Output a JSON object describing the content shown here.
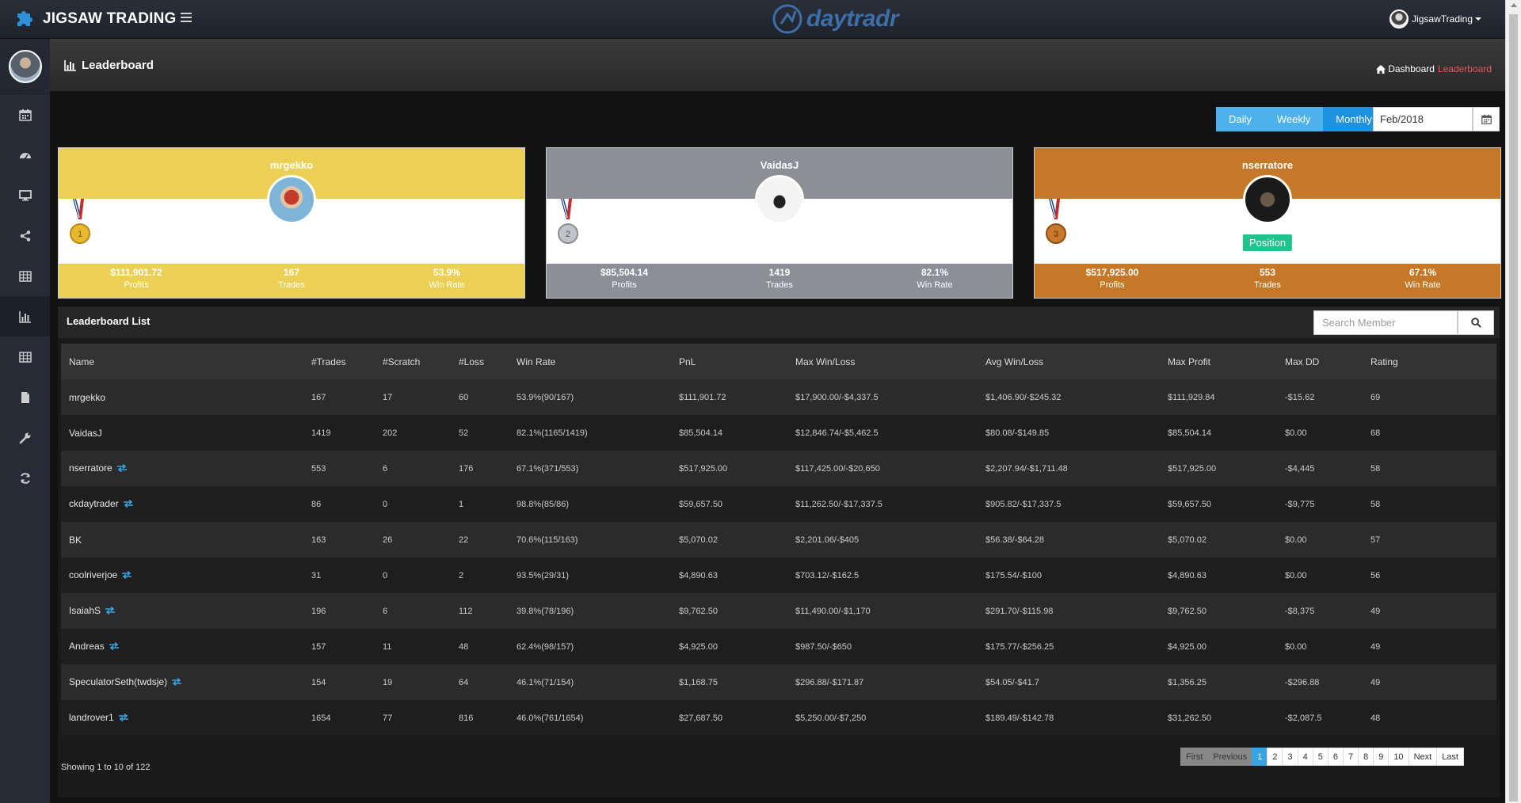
{
  "brand": {
    "name": "JIGSAW TRADING",
    "center_logo": "daytradr"
  },
  "user_menu": {
    "username": "JigsawTrading"
  },
  "sidebar": {
    "items": [
      {
        "icon": "calendar-icon"
      },
      {
        "icon": "dashboard-icon"
      },
      {
        "icon": "monitor-icon"
      },
      {
        "icon": "share-icon"
      },
      {
        "icon": "table-icon"
      },
      {
        "icon": "bar-chart-icon",
        "active": true
      },
      {
        "icon": "table-icon"
      },
      {
        "icon": "file-icon"
      },
      {
        "icon": "wrench-icon"
      },
      {
        "icon": "refresh-icon"
      }
    ]
  },
  "page": {
    "title": "Leaderboard"
  },
  "breadcrumb": {
    "home": "Dashboard",
    "current": "Leaderboard"
  },
  "filters": {
    "daily": "Daily",
    "weekly": "Weekly",
    "monthly": "Monthly",
    "active": "Monthly",
    "date": "Feb/2018"
  },
  "podium": [
    {
      "rank": 1,
      "name": "mrgekko",
      "color": "#ecd055",
      "profits": "$111,901.72",
      "trades": "167",
      "win_rate": "53.9%",
      "badge": ""
    },
    {
      "rank": 2,
      "name": "VaidasJ",
      "color": "#8c8f96",
      "profits": "$85,504.14",
      "trades": "1419",
      "win_rate": "82.1%",
      "badge": ""
    },
    {
      "rank": 3,
      "name": "nserratore",
      "color": "#c57827",
      "profits": "$517,925.00",
      "trades": "553",
      "win_rate": "67.1%",
      "badge": "Position"
    }
  ],
  "podium_labels": {
    "profits": "Profits",
    "trades": "Trades",
    "win_rate": "Win Rate"
  },
  "list": {
    "title": "Leaderboard List",
    "search_placeholder": "Search Member",
    "columns": [
      "Name",
      "#Trades",
      "#Scratch",
      "#Loss",
      "Win Rate",
      "PnL",
      "Max Win/Loss",
      "Avg Win/Loss",
      "Max Profit",
      "Max DD",
      "Rating"
    ],
    "rows": [
      [
        "mrgekko",
        "167",
        "17",
        "60",
        "53.9%(90/167)",
        "$111,901.72",
        "$17,900.00/-$4,337.5",
        "$1,406.90/-$245.32",
        "$111,929.84",
        "-$15.62",
        "69"
      ],
      [
        "VaidasJ",
        "1419",
        "202",
        "52",
        "82.1%(1165/1419)",
        "$85,504.14",
        "$12,846.74/-$5,462.5",
        "$80.08/-$149.85",
        "$85,504.14",
        "$0.00",
        "68"
      ],
      [
        "nserratore",
        "553",
        "6",
        "176",
        "67.1%(371/553)",
        "$517,925.00",
        "$117,425.00/-$20,650",
        "$2,207.94/-$1,711.48",
        "$517,925.00",
        "-$4,445",
        "58"
      ],
      [
        "ckdaytrader",
        "86",
        "0",
        "1",
        "98.8%(85/86)",
        "$59,657.50",
        "$11,262.50/-$17,337.5",
        "$905.82/-$17,337.5",
        "$59,657.50",
        "-$9,775",
        "58"
      ],
      [
        "BK",
        "163",
        "26",
        "22",
        "70.6%(115/163)",
        "$5,070.02",
        "$2,201.06/-$405",
        "$56.38/-$64.28",
        "$5,070.02",
        "$0.00",
        "57"
      ],
      [
        "coolriverjoe",
        "31",
        "0",
        "2",
        "93.5%(29/31)",
        "$4,890.63",
        "$703.12/-$162.5",
        "$175.54/-$100",
        "$4,890.63",
        "$0.00",
        "56"
      ],
      [
        "IsaiahS",
        "196",
        "6",
        "112",
        "39.8%(78/196)",
        "$9,762.50",
        "$11,490.00/-$1,170",
        "$291.70/-$115.98",
        "$9,762.50",
        "-$8,375",
        "49"
      ],
      [
        "Andreas",
        "157",
        "11",
        "48",
        "62.4%(98/157)",
        "$4,925.00",
        "$987.50/-$650",
        "$175.77/-$256.25",
        "$4,925.00",
        "$0.00",
        "49"
      ],
      [
        "SpeculatorSeth(twdsje)",
        "154",
        "19",
        "64",
        "46.1%(71/154)",
        "$1,168.75",
        "$296.88/-$171.87",
        "$54.05/-$41.7",
        "$1,356.25",
        "-$296.88",
        "49"
      ],
      [
        "landrover1",
        "1654",
        "77",
        "816",
        "46.0%(761/1654)",
        "$27,687.50",
        "$5,250.00/-$7,250",
        "$189.49/-$142.78",
        "$31,262.50",
        "-$2,087.5",
        "48"
      ]
    ],
    "swap_rows": [
      false,
      false,
      true,
      true,
      false,
      true,
      true,
      true,
      true,
      true
    ],
    "showing": "Showing 1 to 10 of 122"
  },
  "pagination": {
    "first": "First",
    "previous": "Previous",
    "pages": [
      "1",
      "2",
      "3",
      "4",
      "5",
      "6",
      "7",
      "8",
      "9",
      "10"
    ],
    "active": "1",
    "next": "Next",
    "last": "Last"
  }
}
